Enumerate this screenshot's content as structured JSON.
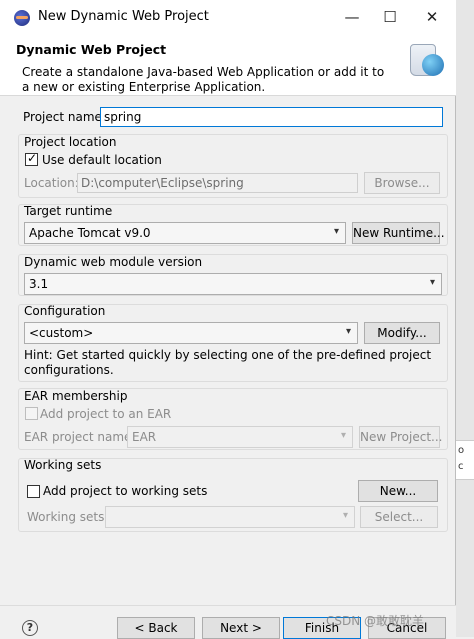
{
  "window": {
    "title": "New Dynamic Web Project"
  },
  "header": {
    "title": "Dynamic Web Project",
    "description": "Create a standalone Java-based Web Application or add it to a new or existing Enterprise Application."
  },
  "project_name": {
    "label": "Project name:",
    "value": "spring"
  },
  "project_location": {
    "group_label": "Project location",
    "use_default_label": "Use default location",
    "use_default_checked": true,
    "location_label": "Location:",
    "location_value": "D:\\computer\\Eclipse\\spring",
    "browse_label": "Browse..."
  },
  "target_runtime": {
    "group_label": "Target runtime",
    "selected": "Apache Tomcat v9.0",
    "new_runtime_label": "New Runtime..."
  },
  "module_version": {
    "group_label": "Dynamic web module version",
    "selected": "3.1"
  },
  "configuration": {
    "group_label": "Configuration",
    "selected": "<custom>",
    "modify_label": "Modify...",
    "hint": "Hint: Get started quickly by selecting one of the pre-defined project configurations."
  },
  "ear": {
    "group_label": "EAR membership",
    "add_label": "Add project to an EAR",
    "name_label": "EAR project name:",
    "name_value": "EAR",
    "new_project_label": "New Project..."
  },
  "working_sets": {
    "group_label": "Working sets",
    "add_label": "Add project to working sets",
    "new_label": "New...",
    "sets_label": "Working sets:",
    "select_label": "Select..."
  },
  "footer": {
    "help": "?",
    "back_label": "< Back",
    "next_label": "Next >",
    "finish_label": "Finish",
    "cancel_label": "Cancel"
  },
  "background": {
    "strip_text_1": "o",
    "strip_text_2": "c"
  },
  "watermark": "CSDN @敢敢耽羊"
}
